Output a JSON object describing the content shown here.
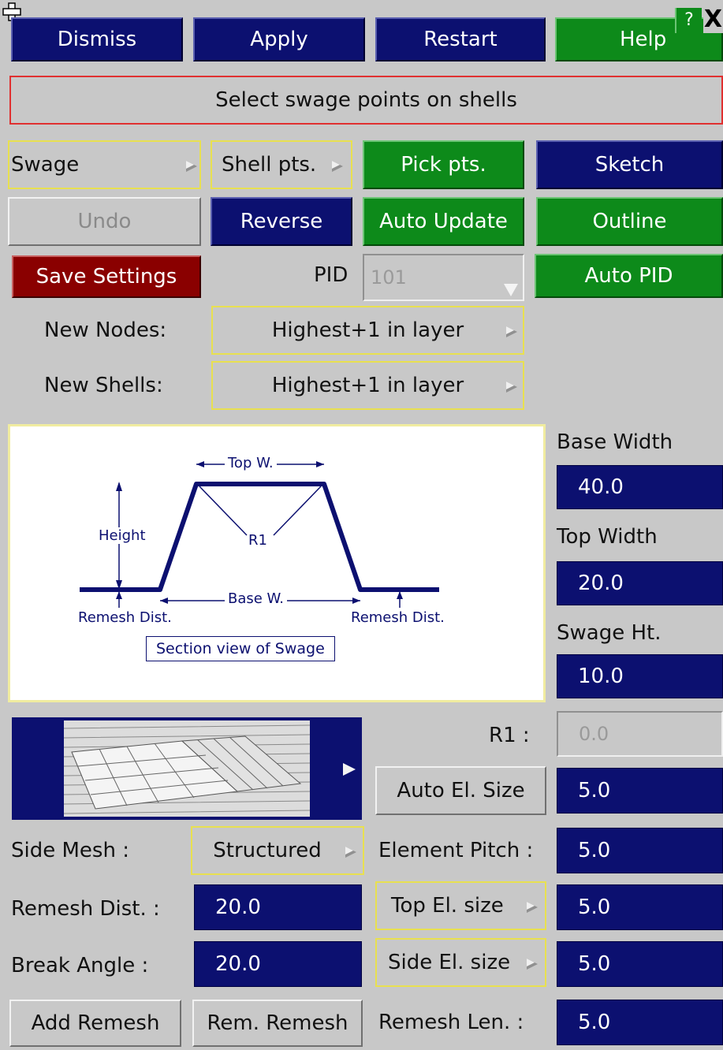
{
  "toolbar": {
    "dismiss": "Dismiss",
    "apply": "Apply",
    "restart": "Restart",
    "help": "Help",
    "question": "?",
    "close": "X"
  },
  "prompt": "Select swage points on shells",
  "row1": {
    "mode": "Swage",
    "points": "Shell pts.",
    "pick": "Pick pts.",
    "sketch": "Sketch"
  },
  "row2": {
    "undo": "Undo",
    "reverse": "Reverse",
    "auto_update": "Auto Update",
    "outline": "Outline"
  },
  "row3": {
    "save": "Save Settings",
    "pid_label": "PID",
    "pid_value": "101",
    "auto_pid": "Auto PID"
  },
  "numbering": {
    "nodes_label": "New Nodes:",
    "nodes_value": "Highest+1 in layer",
    "shells_label": "New Shells:",
    "shells_value": "Highest+1 in layer"
  },
  "diagram": {
    "top_w": "Top W.",
    "height": "Height",
    "r1": "R1",
    "base_w": "Base W.",
    "remesh_left": "Remesh Dist.",
    "remesh_right": "Remesh Dist.",
    "caption": "Section view of Swage"
  },
  "dims": {
    "base_width_label": "Base Width",
    "base_width": "40.0",
    "top_width_label": "Top Width",
    "top_width": "20.0",
    "swage_ht_label": "Swage Ht.",
    "swage_ht": "10.0",
    "r1_label": "R1 :",
    "r1": "0.0"
  },
  "mesh": {
    "auto_el_size": "Auto El. Size",
    "auto_el_value": "5.0",
    "side_mesh_label": "Side Mesh :",
    "side_mesh_value": "Structured",
    "element_pitch_label": "Element Pitch :",
    "element_pitch": "5.0",
    "remesh_dist_label": "Remesh Dist. :",
    "remesh_dist": "20.0",
    "top_el_size": "Top El. size",
    "top_el_value": "5.0",
    "break_angle_label": "Break Angle :",
    "break_angle": "20.0",
    "side_el_size": "Side El. size",
    "side_el_value": "5.0",
    "add_remesh": "Add Remesh",
    "rem_remesh": "Rem. Remesh",
    "remesh_len_label": "Remesh Len. :",
    "remesh_len": "5.0"
  },
  "icons": [
    "move-icon",
    "help-icon",
    "close-icon",
    "menu-arrow-icon",
    "dropdown-arrow-icon"
  ]
}
